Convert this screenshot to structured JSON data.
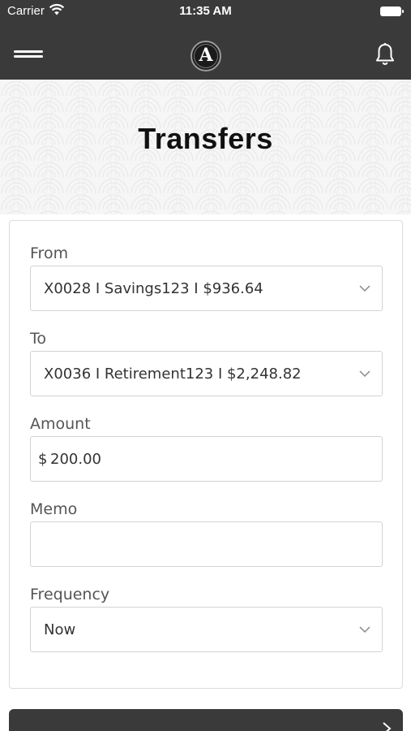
{
  "status_bar": {
    "carrier": "Carrier",
    "time": "11:35 AM",
    "wifi_icon": "wifi-icon",
    "battery_icon": "battery-icon"
  },
  "nav": {
    "menu_icon": "hamburger-menu-icon",
    "logo_letter": "A",
    "notification_icon": "bell-icon"
  },
  "page": {
    "title": "Transfers"
  },
  "form": {
    "from": {
      "label": "From",
      "value": "X0028  I  Savings123  I  $936.64"
    },
    "to": {
      "label": "To",
      "value": "X0036  I  Retirement123  I  $2,248.82"
    },
    "amount": {
      "label": "Amount",
      "currency": "$",
      "value": "200.00"
    },
    "memo": {
      "label": "Memo",
      "value": ""
    },
    "frequency": {
      "label": "Frequency",
      "value": "Now"
    }
  },
  "bottom_button": {
    "label": "",
    "arrow_icon": "chevron-right-icon"
  },
  "colors": {
    "header_bg": "#3a3a3a",
    "card_border": "#dcdcdc",
    "field_border": "#d3d3d3"
  }
}
